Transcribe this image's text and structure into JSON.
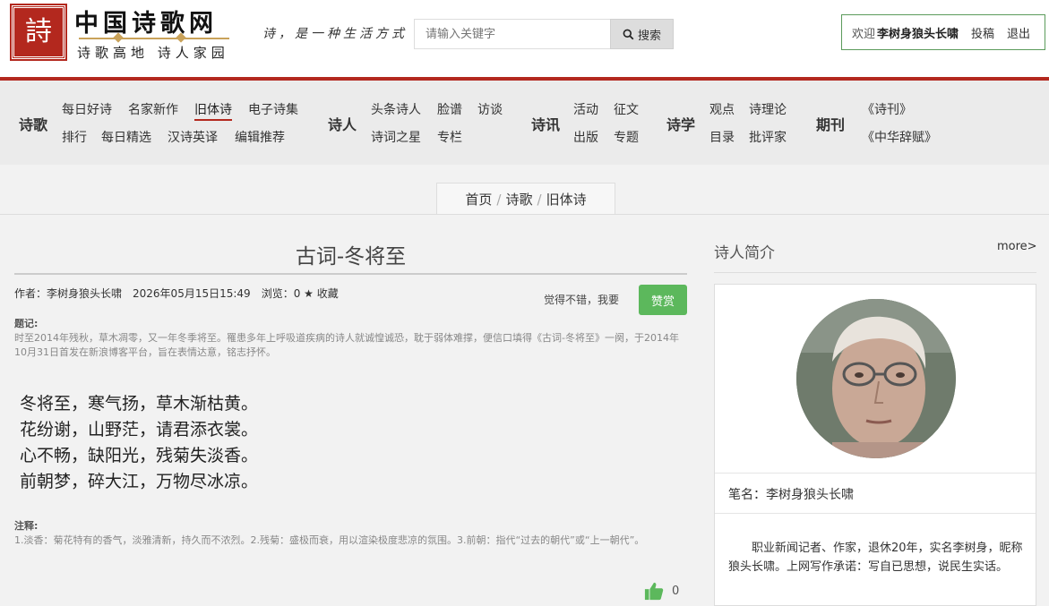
{
  "header": {
    "logo_seal_char": "詩",
    "logo_title": "中国诗歌网",
    "logo_subtitle": "诗歌高地 诗人家园",
    "slogan": "诗，是一种生活方式",
    "search": {
      "placeholder": "请输入关键字",
      "button_label": "搜索"
    },
    "user": {
      "welcome": "欢迎",
      "name": "李树身狼头长啸",
      "submit": "投稿",
      "logout": "退出"
    }
  },
  "nav": {
    "groups": [
      {
        "title": "诗歌",
        "links": [
          "每日好诗",
          "名家新作",
          "旧体诗",
          "电子诗集",
          "排行",
          "每日精选",
          "汉诗英译",
          "编辑推荐"
        ]
      },
      {
        "title": "诗人",
        "links": [
          "头条诗人",
          "脸谱",
          "访谈",
          "诗词之星",
          "专栏"
        ]
      },
      {
        "title": "诗讯",
        "links": [
          "活动",
          "征文",
          "出版",
          "专题"
        ]
      },
      {
        "title": "诗学",
        "links": [
          "观点",
          "诗理论",
          "目录",
          "批评家"
        ]
      },
      {
        "title": "期刊",
        "links": [
          "《诗刊》",
          "《中华辞赋》"
        ]
      }
    ],
    "active": "旧体诗"
  },
  "breadcrumb": {
    "items": [
      "首页",
      "诗歌",
      "旧体诗"
    ],
    "separator": "/"
  },
  "article": {
    "title": "古词-冬将至",
    "author": "作者：李树身狼头长啸",
    "date": "2026年05月15日15:49",
    "views": "浏览：0",
    "favorite": "收藏",
    "praise_prompt": "觉得不错，我要",
    "praise_button": "赞赏",
    "preface_label": "题记:",
    "preface": "时至2014年残秋，草木凋零，又一年冬季将至。罹患多年上呼吸道疾病的诗人就诚惶诚恐，耽于弱体难撑，便信口填得《古词-冬将至》一阕，于2014年10月31日首发在新浪博客平台，旨在表情达意，铭志抒怀。",
    "poem_lines": [
      "冬将至，寒气扬，草木渐枯黄。",
      "花纷谢，山野茫，请君添衣裳。",
      "心不畅，缺阳光，残菊失淡香。",
      "前朝梦，碎大江，万物尽冰凉。"
    ],
    "notes_label": "注释:",
    "notes": "1.淡香：菊花特有的香气，淡雅清新，持久而不浓烈。2.残菊：盛极而衰，用以渲染极度悲凉的氛围。3.前朝：指代“过去的朝代”或“上一朝代”。",
    "likes": "0"
  },
  "sidebar": {
    "title": "诗人简介",
    "more": "more>",
    "pen_name": "笔名：李树身狼头长啸",
    "bio": "职业新闻记者、作家，退休20年，实名李树身，昵称狼头长啸。上网写作承诺：写自已思想，说民生实话。"
  },
  "colors": {
    "brand_red": "#b3281e",
    "praise_green": "#5cb85c",
    "user_box_border": "#5b9b5b"
  },
  "icons": {
    "search": "search-icon",
    "star": "star-icon",
    "like": "thumbs-up-icon"
  }
}
